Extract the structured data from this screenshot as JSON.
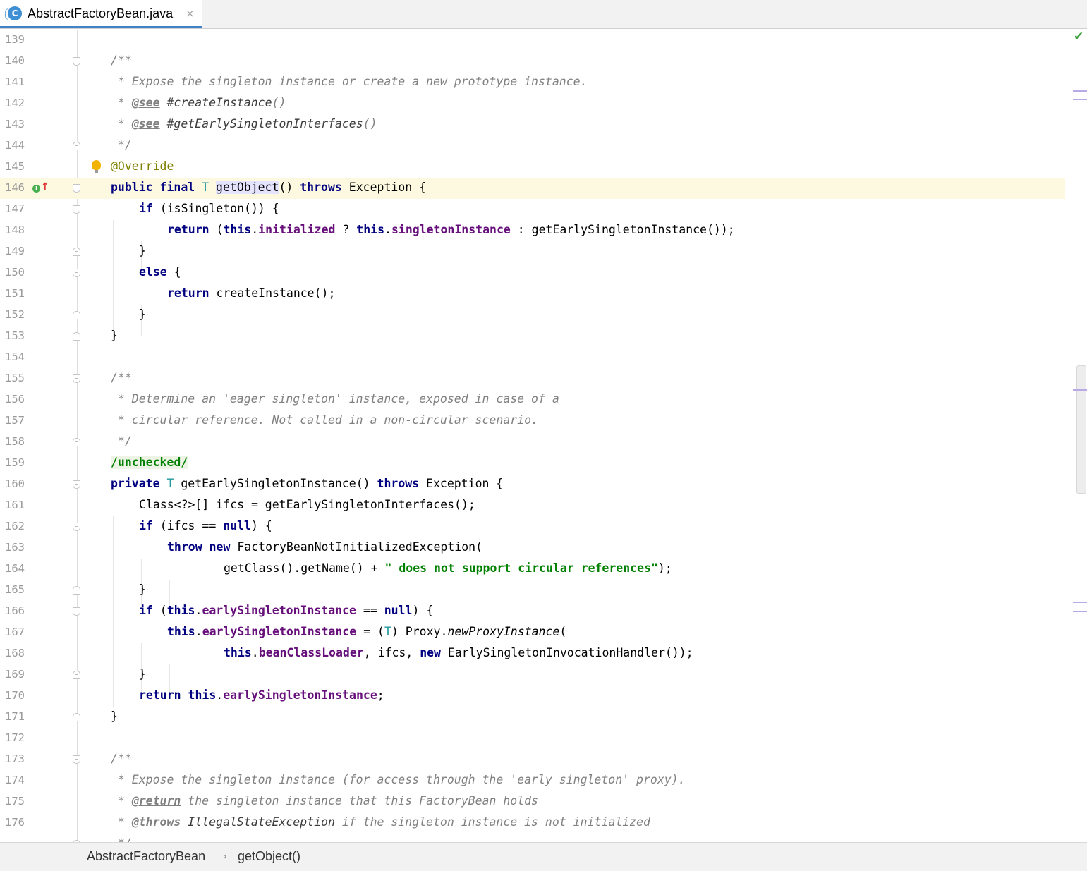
{
  "tab": {
    "title": "AbstractFactoryBean.java",
    "icon": "java-class-icon",
    "close": "×"
  },
  "breadcrumb": {
    "class_name": "AbstractFactoryBean",
    "separator": "›",
    "method": "getObject()"
  },
  "status": {
    "inspection": "✔"
  },
  "editor": {
    "current_line": "146",
    "lines": [
      {
        "n": "139"
      },
      {
        "n": "140"
      },
      {
        "n": "141"
      },
      {
        "n": "142"
      },
      {
        "n": "143"
      },
      {
        "n": "144"
      },
      {
        "n": "145"
      },
      {
        "n": "146"
      },
      {
        "n": "147"
      },
      {
        "n": "148"
      },
      {
        "n": "149"
      },
      {
        "n": "150"
      },
      {
        "n": "151"
      },
      {
        "n": "152"
      },
      {
        "n": "153"
      },
      {
        "n": "154"
      },
      {
        "n": "155"
      },
      {
        "n": "156"
      },
      {
        "n": "157"
      },
      {
        "n": "158"
      },
      {
        "n": "159"
      },
      {
        "n": "160"
      },
      {
        "n": "161"
      },
      {
        "n": "162"
      },
      {
        "n": "163"
      },
      {
        "n": "164"
      },
      {
        "n": "165"
      },
      {
        "n": "166"
      },
      {
        "n": "167"
      },
      {
        "n": "168"
      },
      {
        "n": "169"
      },
      {
        "n": "170"
      },
      {
        "n": "171"
      },
      {
        "n": "172"
      },
      {
        "n": "173"
      },
      {
        "n": "174"
      },
      {
        "n": "175"
      },
      {
        "n": "176"
      }
    ]
  },
  "code": {
    "l140": {
      "a": "/**"
    },
    "l141": {
      "a": " * Expose the singleton instance or create a new prototype instance."
    },
    "l142": {
      "a": " * ",
      "b": "@see",
      "c": " #createInstance",
      "d": "()"
    },
    "l143": {
      "a": " * ",
      "b": "@see",
      "c": " #getEarlySingletonInterfaces",
      "d": "()"
    },
    "l144": {
      "a": " */"
    },
    "l145": {
      "a": "@Override"
    },
    "l146": {
      "a": "public",
      "b": "final",
      "c": "T",
      "d": "getObject",
      "e": "() ",
      "f": "throws",
      "g": " Exception {"
    },
    "l147": {
      "a": "if",
      "b": " (isSingleton()) {"
    },
    "l148": {
      "a": "return",
      "b": " (",
      "c": "this",
      "d": ".",
      "e": "initialized",
      "f": " ? ",
      "g": "this",
      "h": ".",
      "i": "singletonInstance",
      "j": " : getEarlySingletonInstance());"
    },
    "l149": {
      "a": "}"
    },
    "l150": {
      "a": "else",
      "b": " {"
    },
    "l151": {
      "a": "return",
      "b": " createInstance();"
    },
    "l152": {
      "a": "}"
    },
    "l153": {
      "a": "}"
    },
    "l155": {
      "a": "/**"
    },
    "l156": {
      "a": " * Determine an 'eager singleton' instance, exposed in case of a"
    },
    "l157": {
      "a": " * circular reference. Not called in a non-circular scenario."
    },
    "l158": {
      "a": " */"
    },
    "l159": {
      "a": "/unchecked/"
    },
    "l160": {
      "a": "private",
      "b": "T",
      "c": " getEarlySingletonInstance() ",
      "d": "throws",
      "e": " Exception {"
    },
    "l161": {
      "a": "Class<?>[] ifcs = getEarlySingletonInterfaces();"
    },
    "l162": {
      "a": "if",
      "b": " (ifcs == ",
      "c": "null",
      "d": ") {"
    },
    "l163": {
      "a": "throw",
      "b": "new",
      "c": " FactoryBeanNotInitializedException("
    },
    "l164": {
      "a": "getClass().getName() + ",
      "b": "\" does not support circular references\"",
      "c": ");"
    },
    "l165": {
      "a": "}"
    },
    "l166": {
      "a": "if",
      "b": " (",
      "c": "this",
      "d": ".",
      "e": "earlySingletonInstance",
      "f": " == ",
      "g": "null",
      "h": ") {"
    },
    "l167": {
      "a": "this",
      "b": ".",
      "c": "earlySingletonInstance",
      "d": " = (",
      "e": "T",
      "f": ") Proxy.",
      "g": "newProxyInstance",
      "h": "("
    },
    "l168": {
      "a": "this",
      "b": ".",
      "c": "beanClassLoader",
      "d": ", ifcs, ",
      "e": "new",
      "f": " EarlySingletonInvocationHandler());"
    },
    "l169": {
      "a": "}"
    },
    "l170": {
      "a": "return",
      "b": "this",
      "c": ".",
      "d": "earlySingletonInstance",
      "e": ";"
    },
    "l171": {
      "a": "}"
    },
    "l173": {
      "a": "/**"
    },
    "l174": {
      "a": " * Expose the singleton instance (for access through the 'early singleton' proxy)."
    },
    "l175": {
      "a": " * ",
      "b": "@return",
      "c": " the singleton instance that this FactoryBean holds"
    },
    "l176": {
      "a": " * ",
      "b": "@throws",
      "c": " IllegalStateException",
      "d": " if the singleton instance is not initialized"
    },
    "l177": {
      "a": " */"
    }
  }
}
